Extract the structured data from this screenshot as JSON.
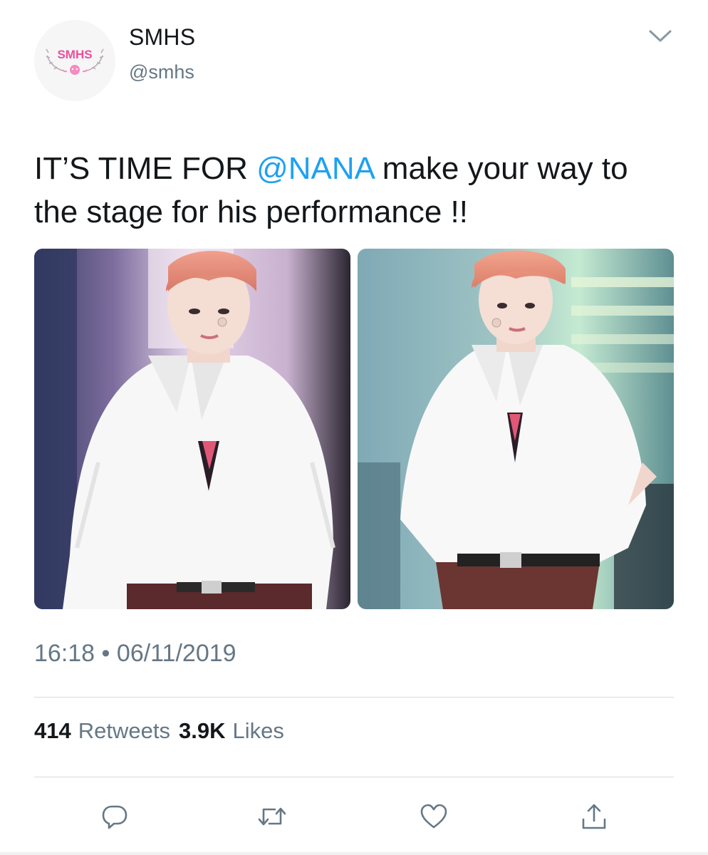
{
  "user": {
    "display_name": "SMHS",
    "handle": "@smhs",
    "avatar_logo_text": "SMHS",
    "avatar_icon": "smhs-logo"
  },
  "header": {
    "menu_icon": "chevron-down-icon"
  },
  "tweet": {
    "text_before": "IT’S TIME FOR ",
    "mention": "@NANA",
    "text_after": " make your way to the stage for his performance !!"
  },
  "media": {
    "count": 2,
    "photos": [
      {
        "name": "performance-photo-1"
      },
      {
        "name": "performance-photo-2"
      }
    ]
  },
  "meta": {
    "time": "16:18",
    "separator": "•",
    "date": "06/11/2019"
  },
  "stats": {
    "retweets_count": "414",
    "retweets_label": "Retweets",
    "likes_count": "3.9K",
    "likes_label": "Likes"
  },
  "actions": {
    "reply_icon": "reply-icon",
    "retweet_icon": "retweet-icon",
    "like_icon": "heart-icon",
    "share_icon": "share-icon"
  },
  "colors": {
    "text": "#14171a",
    "secondary": "#657786",
    "link": "#1da1f2",
    "divider": "#d6dbdf",
    "brand_pink": "#ee4d9a"
  }
}
